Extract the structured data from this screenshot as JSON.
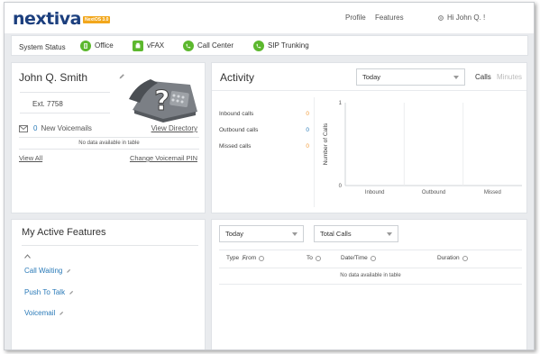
{
  "header": {
    "logo_text": "nextiva",
    "logo_badge": "NextOS 3.0",
    "nav": {
      "profile": "Profile",
      "features": "Features",
      "user": "Hi John Q. !"
    }
  },
  "status_bar": {
    "label": "System Status",
    "items": [
      {
        "label": "Office",
        "icon": "office-icon"
      },
      {
        "label": "vFAX",
        "icon": "fax-icon"
      },
      {
        "label": "Call Center",
        "icon": "call-center-icon"
      },
      {
        "label": "SIP Trunking",
        "icon": "sip-trunking-icon"
      }
    ],
    "status_color": "#5cb82e"
  },
  "user_card": {
    "name": "John Q. Smith",
    "extension": "Ext. 7758",
    "voicemail_count": "0",
    "voicemail_label": "New Voicemails",
    "view_directory": "View Directory",
    "no_data": "No data available in table",
    "view_all": "View All",
    "change_pin": "Change Voicemail PIN"
  },
  "activity": {
    "title": "Activity",
    "period": "Today",
    "tabs": [
      "Calls",
      "Minutes"
    ],
    "metrics": [
      {
        "label": "Inbound calls",
        "value": "0"
      },
      {
        "label": "Outbound calls",
        "value": "0"
      },
      {
        "label": "Missed calls",
        "value": "0"
      }
    ]
  },
  "chart_data": {
    "type": "bar",
    "categories": [
      "Inbound",
      "Outbound",
      "Missed"
    ],
    "values": [
      0,
      0,
      0
    ],
    "ylabel": "Number of Calls",
    "ylim": [
      0,
      1
    ],
    "yticks": [
      "0",
      "1"
    ],
    "grid": true
  },
  "features": {
    "title": "My Active Features",
    "items": [
      "Call Waiting",
      "Push To Talk",
      "Voicemail"
    ]
  },
  "calls_table": {
    "period": "Today",
    "filter": "Total Calls",
    "columns": [
      "Type",
      "From",
      "To",
      "Date/Time",
      "Duration"
    ],
    "no_data": "No data available in table"
  },
  "colors": {
    "brand_blue": "#1c3f7e",
    "accent_orange": "#f39c3a",
    "link_blue": "#2a7ab8",
    "background": "#e9ebee"
  }
}
